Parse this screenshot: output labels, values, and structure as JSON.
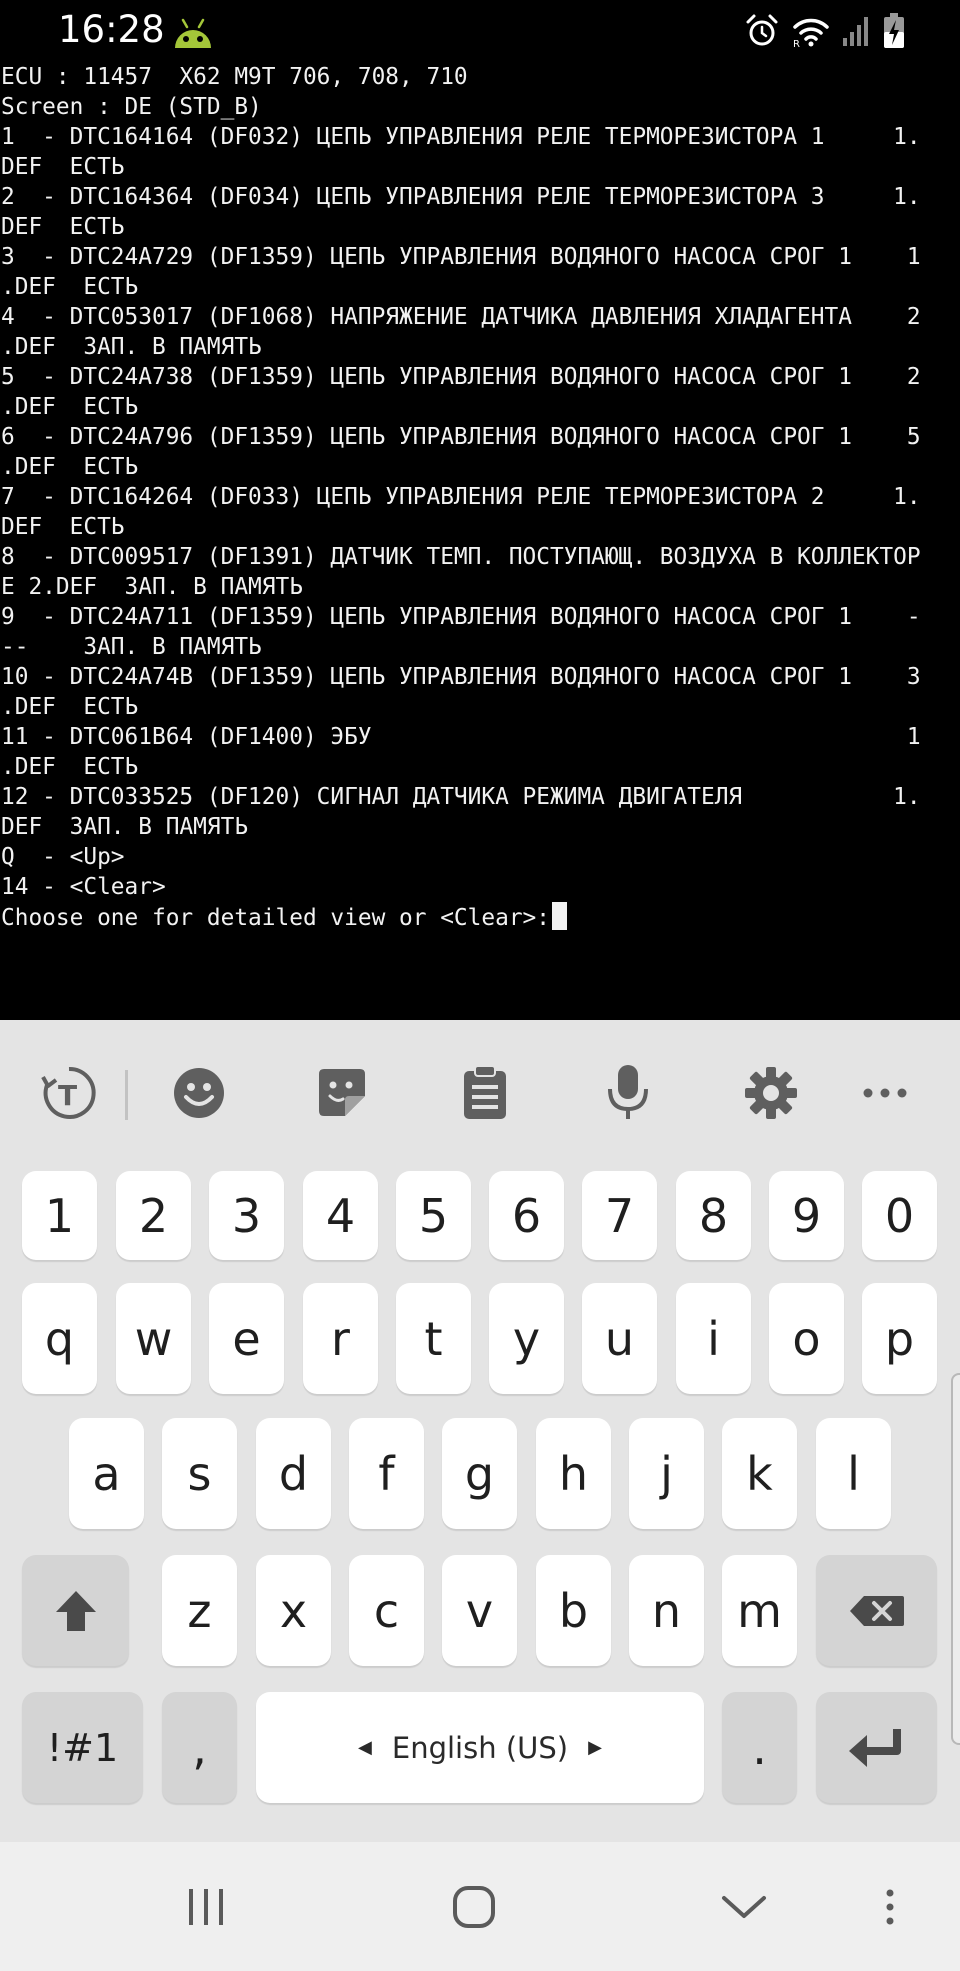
{
  "status_bar": {
    "time": "16:28",
    "icons": [
      "android-debug-icon",
      "alarm-icon",
      "wifi-icon",
      "signal-icon",
      "battery-charging-icon"
    ],
    "battery_level_percent": 50
  },
  "terminal": {
    "lines": [
      "ECU : 11457  X62 M9T 706, 708, 710",
      "Screen : DE (STD_B)",
      "1  - DTC164164 (DF032) ЦЕПЬ УПРАВЛЕНИЯ РЕЛЕ ТЕРМОРЕЗИСТОРА 1     1.",
      "DEF  ЕСТЬ",
      "2  - DTC164364 (DF034) ЦЕПЬ УПРАВЛЕНИЯ РЕЛЕ ТЕРМОРЕЗИСТОРА 3     1.",
      "DEF  ЕСТЬ",
      "3  - DTC24A729 (DF1359) ЦЕПЬ УПРАВЛЕНИЯ ВОДЯНОГО НАСОСА СРОГ 1    1",
      ".DEF  ЕСТЬ",
      "4  - DTC053017 (DF1068) НАПРЯЖЕНИЕ ДАТЧИКА ДАВЛЕНИЯ ХЛАДАГЕНТА    2",
      ".DEF  ЗАП. В ПАМЯТЬ",
      "5  - DTC24A738 (DF1359) ЦЕПЬ УПРАВЛЕНИЯ ВОДЯНОГО НАСОСА СРОГ 1    2",
      ".DEF  ЕСТЬ",
      "6  - DTC24A796 (DF1359) ЦЕПЬ УПРАВЛЕНИЯ ВОДЯНОГО НАСОСА СРОГ 1    5",
      ".DEF  ЕСТЬ",
      "7  - DTC164264 (DF033) ЦЕПЬ УПРАВЛЕНИЯ РЕЛЕ ТЕРМОРЕЗИСТОРА 2     1.",
      "DEF  ЕСТЬ",
      "8  - DTC009517 (DF1391) ДАТЧИК ТЕМП. ПОСТУПАЮЩ. ВОЗДУХА В КОЛЛЕКТОР",
      "Е 2.DEF  ЗАП. В ПАМЯТЬ",
      "9  - DTC24A711 (DF1359) ЦЕПЬ УПРАВЛЕНИЯ ВОДЯНОГО НАСОСА СРОГ 1    -",
      "--    ЗАП. В ПАМЯТЬ",
      "10 - DTC24A74B (DF1359) ЦЕПЬ УПРАВЛЕНИЯ ВОДЯНОГО НАСОСА СРОГ 1    3",
      ".DEF  ЕСТЬ",
      "11 - DTC061B64 (DF1400) ЭБУ                                       1",
      ".DEF  ЕСТЬ",
      "12 - DTC033525 (DF120) СИГНАЛ ДАТЧИКА РЕЖИМА ДВИГАТЕЛЯ           1.",
      "DEF  ЗАП. В ПАМЯТЬ",
      "Q  - <Up>",
      "14 - <Clear>"
    ],
    "prompt": "Choose one for detailed view or <Clear>:"
  },
  "keyboard": {
    "toolbar": [
      "translate-icon",
      "emoji-icon",
      "sticker-icon",
      "clipboard-icon",
      "microphone-icon",
      "settings-gear-icon",
      "more-options-icon"
    ],
    "row_numbers": [
      "1",
      "2",
      "3",
      "4",
      "5",
      "6",
      "7",
      "8",
      "9",
      "0"
    ],
    "row_top": [
      "q",
      "w",
      "e",
      "r",
      "t",
      "y",
      "u",
      "i",
      "o",
      "p"
    ],
    "row_middle": [
      "a",
      "s",
      "d",
      "f",
      "g",
      "h",
      "j",
      "k",
      "l"
    ],
    "row_bottom": [
      "z",
      "x",
      "c",
      "v",
      "b",
      "n",
      "m"
    ],
    "symbols_label": "!#1",
    "comma_label": ",",
    "space_label": "English (US)",
    "period_label": "."
  },
  "nav_bar": {
    "buttons": [
      "recent-apps-icon",
      "home-icon",
      "hide-keyboard-icon",
      "keyboard-menu-icon"
    ]
  },
  "colors": {
    "terminal_bg": "#000000",
    "terminal_text": "#f2f2f2",
    "keyboard_bg": "#e4e4e4",
    "key_bg": "#ffffff",
    "special_key_bg": "#d4d4d4",
    "navbar_bg": "#efefef",
    "android_icon": "#a4c639"
  }
}
